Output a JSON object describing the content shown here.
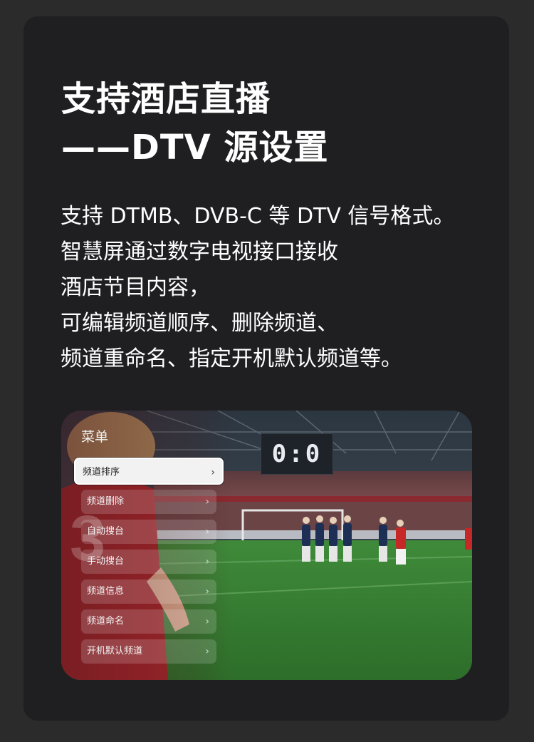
{
  "heading": {
    "line1": "支持酒店直播",
    "line2": "——DTV 源设置"
  },
  "description": {
    "lines": [
      "支持 DTMB、DVB-C 等 DTV 信号格式。",
      "智慧屏通过数字电视接口接收",
      "酒店节目内容，",
      "可编辑频道顺序、删除频道、",
      "频道重命名、指定开机默认频道等。"
    ]
  },
  "tv_screen": {
    "scoreboard": "0:0",
    "menu": {
      "title": "菜单",
      "selected_index": 0,
      "items": [
        {
          "label": "频道排序",
          "icon": "chevron-right-icon"
        },
        {
          "label": "频道删除",
          "icon": "chevron-right-icon"
        },
        {
          "label": "自动搜台",
          "icon": "chevron-right-icon"
        },
        {
          "label": "手动搜台",
          "icon": "chevron-right-icon"
        },
        {
          "label": "频道信息",
          "icon": "chevron-right-icon"
        },
        {
          "label": "频道命名",
          "icon": "chevron-right-icon"
        },
        {
          "label": "开机默认频道",
          "icon": "chevron-right-icon"
        }
      ]
    }
  },
  "colors": {
    "page_background": "#2b2b2b",
    "card_background": "#1f1f21",
    "text_primary": "#ffffff",
    "menu_selected_background": "#f2f2f2"
  }
}
